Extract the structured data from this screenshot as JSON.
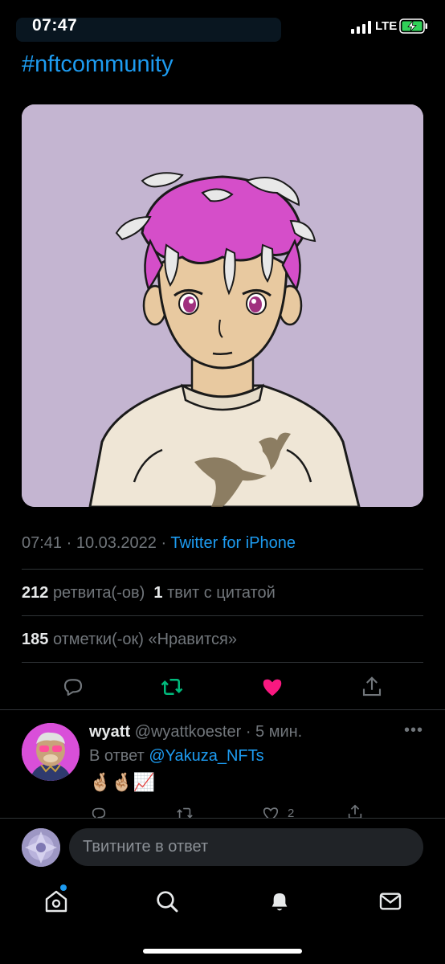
{
  "status_bar": {
    "time": "07:47",
    "network": "LTE"
  },
  "tweet": {
    "hashtag": "#nftcommunity",
    "timestamp": "07:41 · 10.03.2022 · ",
    "source": "Twitter for iPhone",
    "retweets_count": "212",
    "retweets_label": "ретвита(-ов)",
    "quotes_count": "1",
    "quotes_label": "твит с цитатой",
    "likes_count": "185",
    "likes_label": "отметки(-ок) «Нравится»",
    "liked": true,
    "colors": {
      "accent": "#1d9bf0",
      "retweet": "#00ba7c",
      "like": "#f91880"
    }
  },
  "reply": {
    "name": "wyatt",
    "handle": "@wyattkoester",
    "time": " · 5 мин.",
    "reply_prefix": "В ответ ",
    "reply_mention": "@Yakuza_NFTs",
    "emojis": "🤞🏼🤞🏼📈",
    "like_count": "2"
  },
  "composer": {
    "placeholder": "Твитните в ответ"
  },
  "tabs": [
    "home-icon",
    "search-icon",
    "notifications-icon",
    "messages-icon"
  ]
}
